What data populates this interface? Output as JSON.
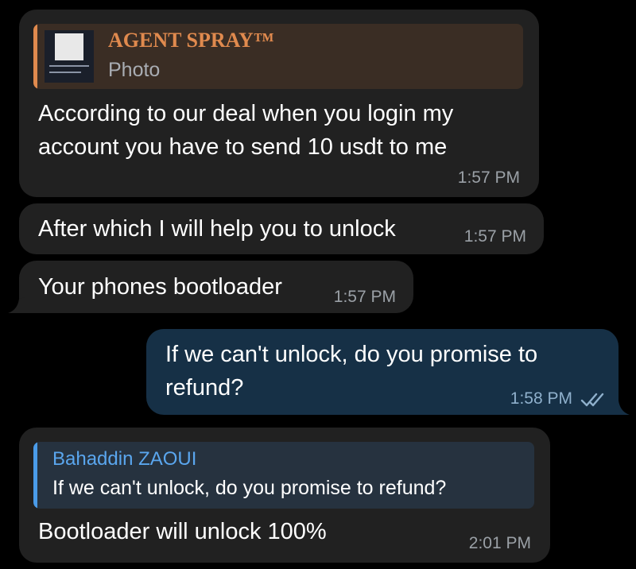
{
  "colors": {
    "incoming_bubble": "#212121",
    "outgoing_bubble": "#163046",
    "reply_orange": "#e08a4e",
    "reply_blue": "#4a9be8",
    "timestamp": "#9aa0a6"
  },
  "messages": [
    {
      "direction": "incoming",
      "reply": {
        "sender": "AGENT SPRAY™",
        "preview": "Photo",
        "has_thumbnail": true
      },
      "lines": [
        "According to our deal when you login my",
        "account you have to send 10 usdt to me"
      ],
      "time": "1:57 PM"
    },
    {
      "direction": "incoming",
      "text": "After which I will help you to unlock",
      "time": "1:57 PM"
    },
    {
      "direction": "incoming",
      "text": "Your phones bootloader",
      "time": "1:57 PM"
    },
    {
      "direction": "outgoing",
      "lines": [
        "If we can't unlock, do you promise to",
        "refund?"
      ],
      "time": "1:58 PM",
      "status_icon": "double-check-icon"
    },
    {
      "direction": "incoming",
      "reply": {
        "sender": "Bahaddin ZAOUI",
        "preview": "If we can't unlock, do you promise to refund?"
      },
      "text": "Bootloader will unlock 100%",
      "time": "2:01 PM"
    }
  ]
}
